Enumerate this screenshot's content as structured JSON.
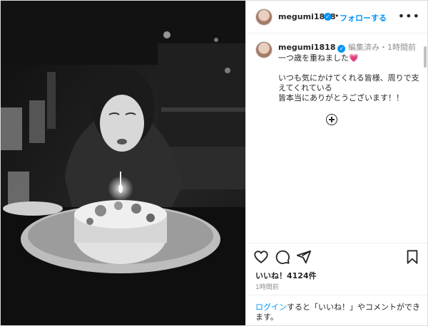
{
  "post": {
    "username": "megumi1818",
    "verified_mark": "✓",
    "follow_label": "フォローする",
    "separator": "•",
    "more_icon": "more-horizontal-icon"
  },
  "caption": {
    "username": "megumi1818",
    "edited": "編集済み",
    "separator": "・",
    "time": "1時間前",
    "line1": "一つ歳を重ねました",
    "heart": "💗",
    "line2": "いつも気にかけてくれる皆様、周りで支えてくれている",
    "line3": "皆本当にありがとうございます！！",
    "expand_icon": "plus-circle-icon"
  },
  "actions": {
    "icons": [
      "heart-icon",
      "comment-icon",
      "share-icon",
      "bookmark-icon"
    ],
    "likes": "いいね！4124件",
    "time": "1時間前"
  },
  "login": {
    "link": "ログイン",
    "text": "すると「いいね！」やコメントができます。"
  },
  "colors": {
    "accent": "#0095f6",
    "text": "#262626",
    "muted": "#8e8e8e",
    "heart_pink": "#e6399b"
  }
}
